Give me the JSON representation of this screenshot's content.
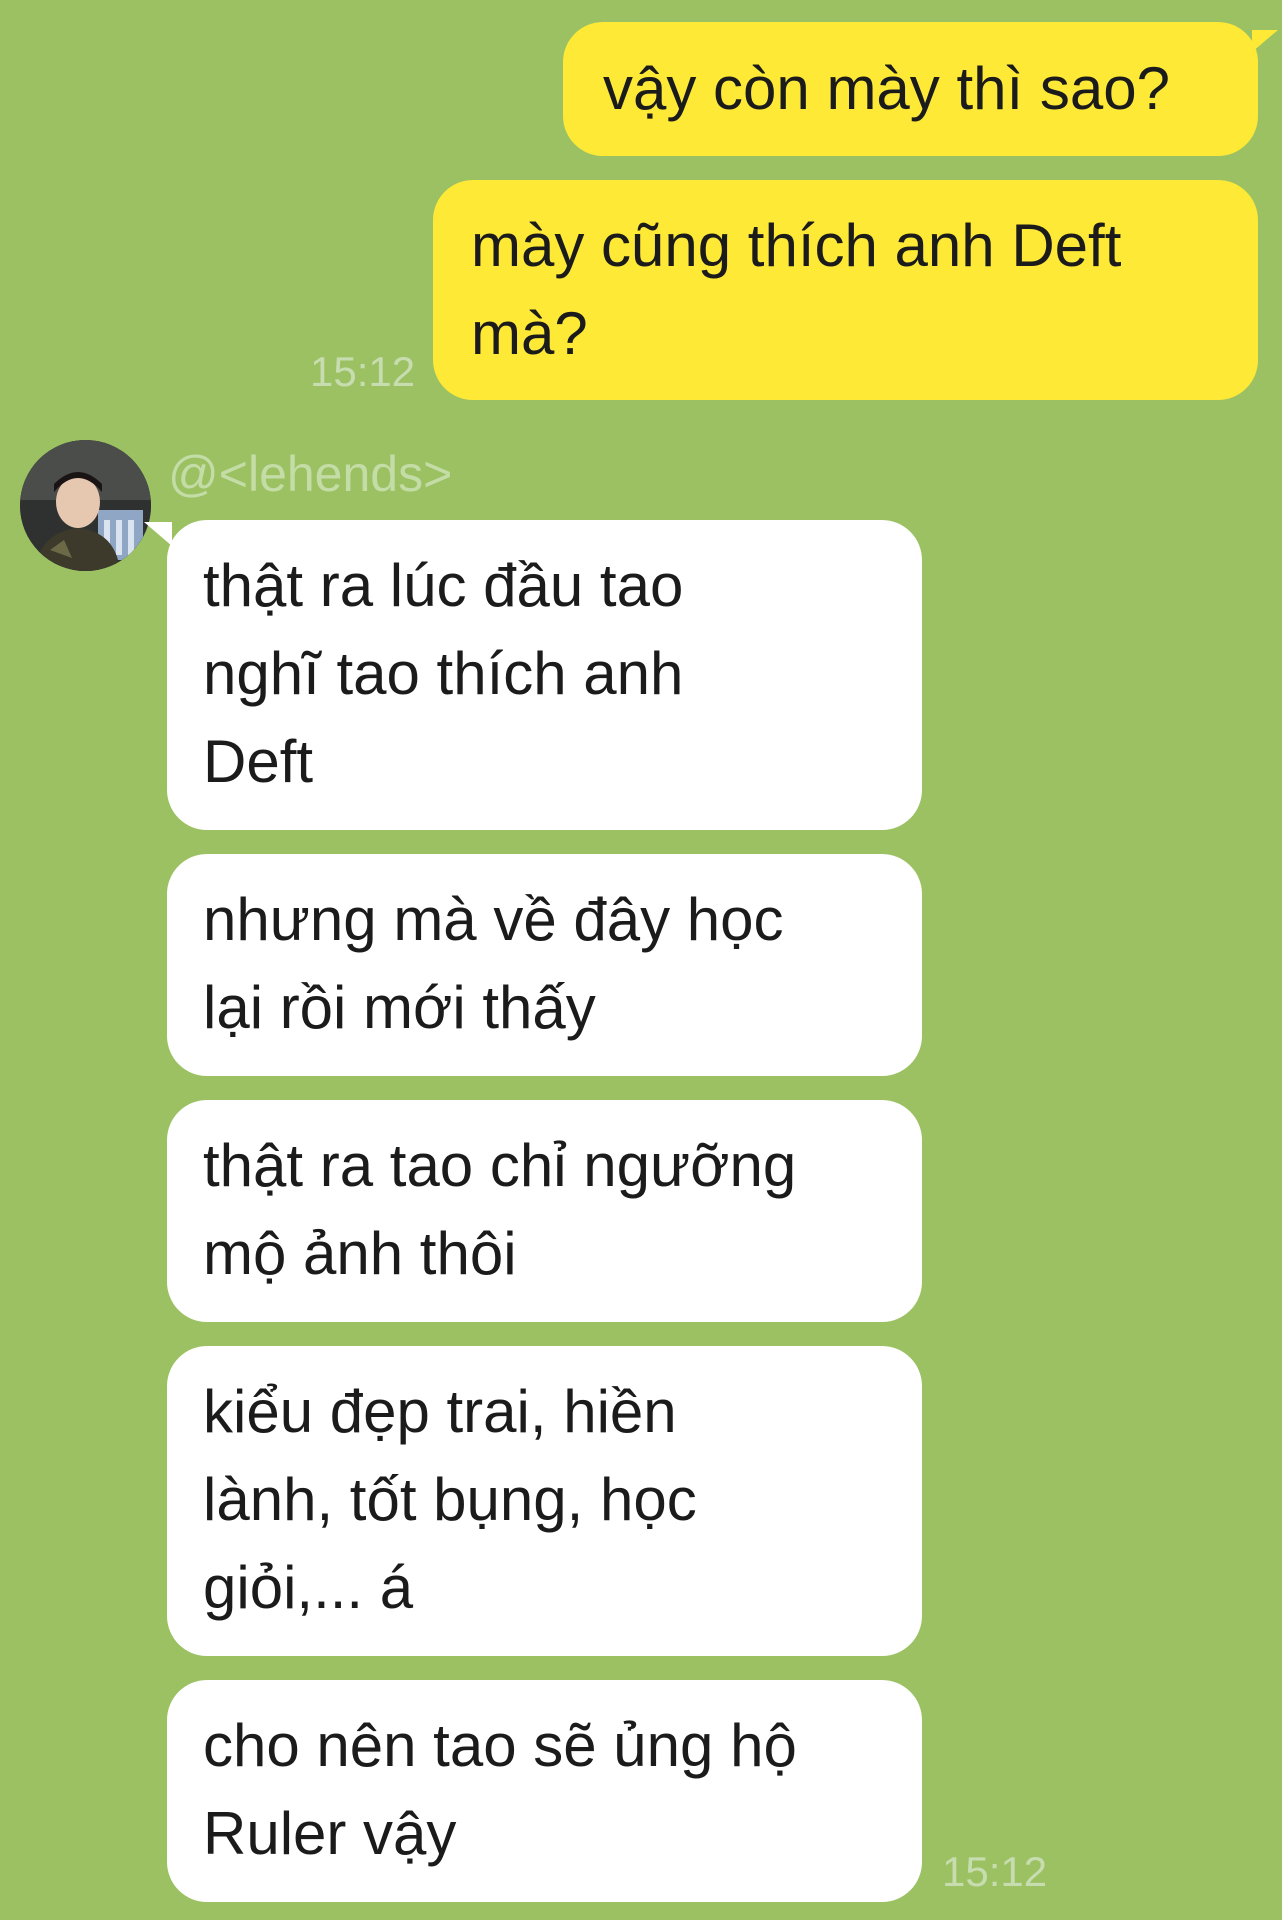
{
  "chat": {
    "outgoing": [
      {
        "text": "vậy còn mày thì sao?"
      },
      {
        "text": "mày cũng thích anh Deft\nmà?"
      }
    ],
    "outgoing_time": "15:12",
    "sender_name": "@<lehends>",
    "avatar_icon": "user-avatar-photo",
    "incoming": [
      {
        "text": "thật ra lúc đầu tao\nnghĩ tao thích anh\nDeft"
      },
      {
        "text": "nhưng mà về đây học\nlại rồi mới thấy"
      },
      {
        "text": "thật ra tao chỉ ngưỡng\nmộ ảnh thôi"
      },
      {
        "text": "kiểu đẹp trai, hiền\nlành, tốt bụng, học\ngiỏi,... á"
      },
      {
        "text": "cho nên tao sẽ ủng hộ\nRuler vậy"
      }
    ],
    "incoming_time": "15:12"
  },
  "colors": {
    "background": "#9cc163",
    "outgoing_bubble": "#fde936",
    "incoming_bubble": "#ffffff",
    "timestamp": "#c7ddb0"
  }
}
